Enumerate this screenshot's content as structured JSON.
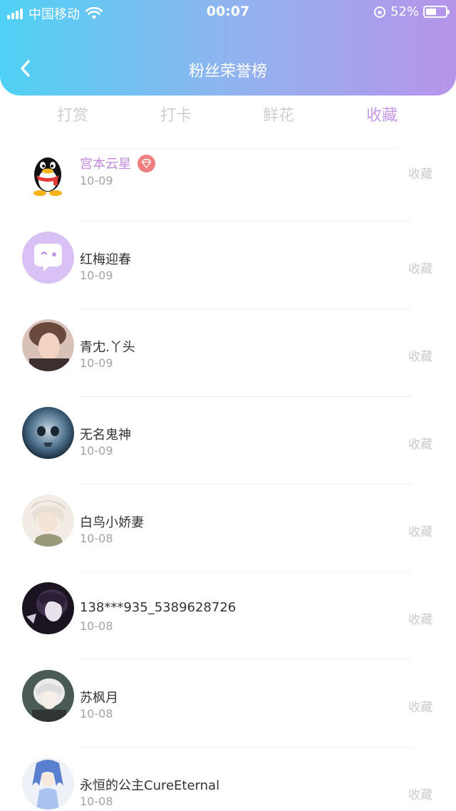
{
  "status_bar": {
    "carrier": "中国移动",
    "time": "00:07",
    "battery": "52%",
    "battery_level": 0.52,
    "icons": [
      "signal-icon",
      "wifi-icon",
      "rotation-lock-icon",
      "battery-icon"
    ]
  },
  "header": {
    "title": "粉丝荣誉榜",
    "back_icon": "chevron-left-icon",
    "gradient_colors": [
      "#4fd1f5",
      "#b694ea"
    ]
  },
  "tabs": [
    {
      "label": "打赏",
      "active": false
    },
    {
      "label": "打卡",
      "active": false
    },
    {
      "label": "鲜花",
      "active": false
    },
    {
      "label": "收藏",
      "active": true
    }
  ],
  "accent_color": "#c79ae6",
  "rows": [
    {
      "name": "宫本云星",
      "date": "10-09",
      "action": "收藏",
      "vip": true,
      "avatar": "qq-penguin-avatar"
    },
    {
      "name": "红梅迎春",
      "date": "10-09",
      "action": "收藏",
      "vip": false,
      "avatar": "default-chat-avatar"
    },
    {
      "name": "青冘.丫头",
      "date": "10-09",
      "action": "收藏",
      "vip": false,
      "avatar": "photo-avatar"
    },
    {
      "name": "无名鬼神",
      "date": "10-09",
      "action": "收藏",
      "vip": false,
      "avatar": "photo-avatar"
    },
    {
      "name": "白鸟小娇妻",
      "date": "10-08",
      "action": "收藏",
      "vip": false,
      "avatar": "photo-avatar"
    },
    {
      "name": "138***935_5389628726",
      "date": "10-08",
      "action": "收藏",
      "vip": false,
      "avatar": "photo-avatar"
    },
    {
      "name": "苏枫月",
      "date": "10-08",
      "action": "收藏",
      "vip": false,
      "avatar": "photo-avatar"
    },
    {
      "name": "永恒的公主CureEternal",
      "date": "10-08",
      "action": "收藏",
      "vip": false,
      "avatar": "photo-avatar"
    }
  ]
}
